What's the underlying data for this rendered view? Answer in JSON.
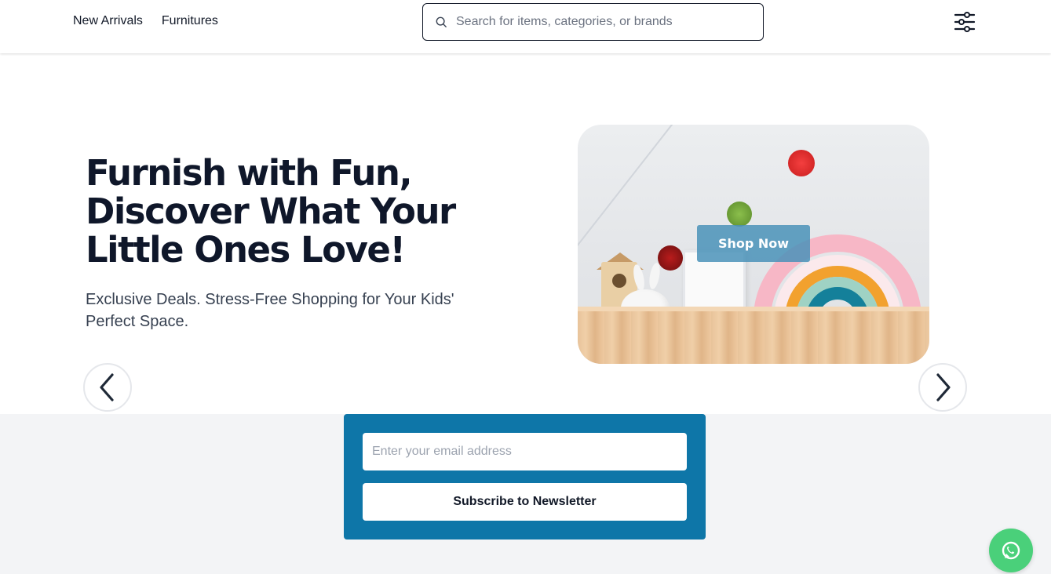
{
  "header": {
    "nav": [
      {
        "label": "New Arrivals"
      },
      {
        "label": "Furnitures"
      }
    ],
    "search": {
      "placeholder": "Search for items, categories, or brands",
      "icon": "search-icon"
    },
    "filter_icon": "sliders-icon"
  },
  "hero": {
    "title": "Furnish with Fun, Discover What Your Little Ones Love!",
    "subtitle": "Exclusive Deals. Stress-Free Shopping for Your Kids' Perfect Space.",
    "cta_label": "Shop Now",
    "prev_icon": "chevron-left-icon",
    "next_icon": "chevron-right-icon"
  },
  "newsletter": {
    "email_placeholder": "Enter your email address",
    "subscribe_label": "Subscribe to Newsletter"
  },
  "floating": {
    "whatsapp_icon": "whatsapp-icon"
  },
  "colors": {
    "accent": "#0e76a8",
    "whatsapp": "#4ad07a",
    "cta": "#4a92b9"
  }
}
